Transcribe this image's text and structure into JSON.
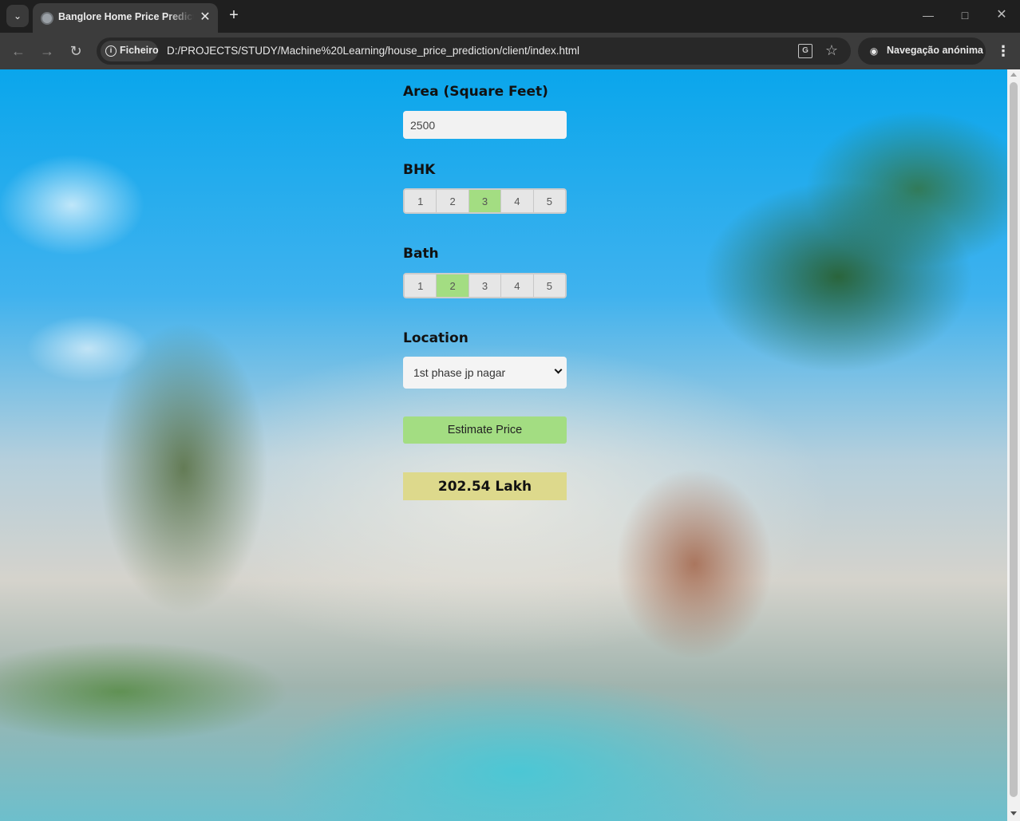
{
  "browser": {
    "tab_title": "Banglore Home Price Prediction",
    "site_chip_label": "Ficheiro",
    "url": "D:/PROJECTS/STUDY/Machine%20Learning/house_price_prediction/client/index.html",
    "incognito_label": "Navegação anónima"
  },
  "form": {
    "area_label": "Area (Square Feet)",
    "area_value": "2500",
    "bhk_label": "BHK",
    "bhk_options": [
      "1",
      "2",
      "3",
      "4",
      "5"
    ],
    "bhk_selected": "3",
    "bath_label": "Bath",
    "bath_options": [
      "1",
      "2",
      "3",
      "4",
      "5"
    ],
    "bath_selected": "2",
    "location_label": "Location",
    "location_selected": "1st phase jp nagar",
    "estimate_button": "Estimate Price",
    "estimated_price": "202.54 Lakh"
  },
  "colors": {
    "selected_option": "#a3dd82",
    "estimate_button": "#a3dd82",
    "result_background": "#ddd98c"
  }
}
